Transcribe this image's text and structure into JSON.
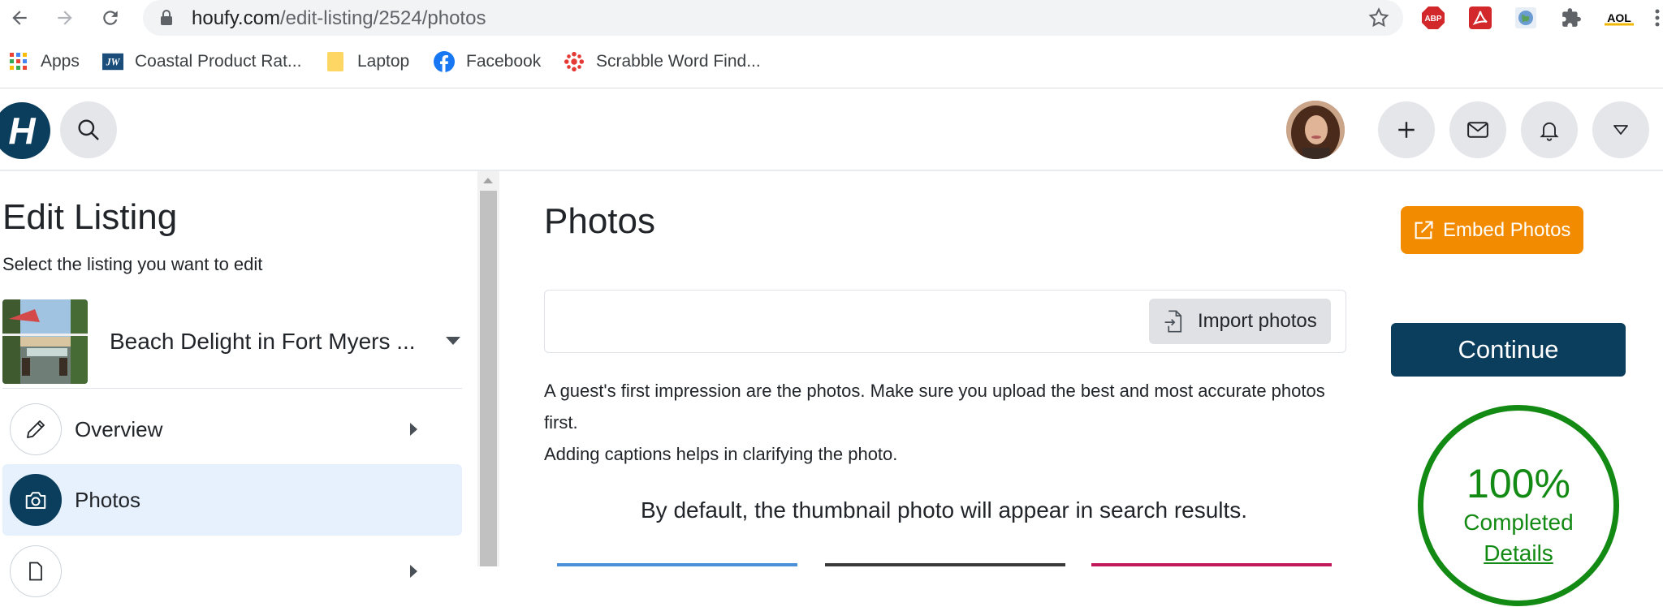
{
  "browser": {
    "url_host": "houfy.com",
    "url_path": "/edit-listing/2524/photos",
    "extensions": [
      {
        "name": "adblock-plus-icon",
        "label": "ABP",
        "color": "#d2282b"
      },
      {
        "name": "adobe-acrobat-icon",
        "label": "",
        "color": "#d2282b"
      },
      {
        "name": "globe-extension-icon",
        "label": "",
        "color": "#6a9bd1"
      },
      {
        "name": "extensions-puzzle-icon",
        "label": "",
        "color": "#5f6368"
      },
      {
        "name": "aol-icon",
        "label": "AOL",
        "color": "#000000"
      }
    ],
    "bookmarks": [
      {
        "label": "Apps",
        "icon": "apps-grid-icon"
      },
      {
        "label": "Coastal Product Rat...",
        "icon": "jw-site-icon"
      },
      {
        "label": "Laptop",
        "icon": "folder-icon"
      },
      {
        "label": "Facebook",
        "icon": "facebook-icon"
      },
      {
        "label": "Scrabble Word Find...",
        "icon": "scrabble-icon"
      }
    ]
  },
  "header": {
    "logo_letter": "H",
    "brand_color": "#0b3d5c"
  },
  "sidebar": {
    "title": "Edit Listing",
    "subtitle": "Select the listing you want to edit",
    "listing_name": "Beach Delight in Fort Myers ...",
    "items": [
      {
        "label": "Overview",
        "icon": "pencil-icon",
        "active": false
      },
      {
        "label": "Photos",
        "icon": "camera-icon",
        "active": true
      }
    ]
  },
  "main": {
    "title": "Photos",
    "import_label": "Import photos",
    "description_line1": "A guest's first impression are the photos. Make sure you upload the best and most accurate photos first.",
    "description_line2": "Adding captions helps in clarifying the photo.",
    "default_note": "By default, the thumbnail photo will appear in search results."
  },
  "right": {
    "embed_label": "Embed Photos",
    "embed_color": "#f28b00",
    "continue_label": "Continue",
    "progress_value": "100%",
    "progress_label": "Completed",
    "details_link": "Details",
    "progress_color": "#138a13"
  }
}
